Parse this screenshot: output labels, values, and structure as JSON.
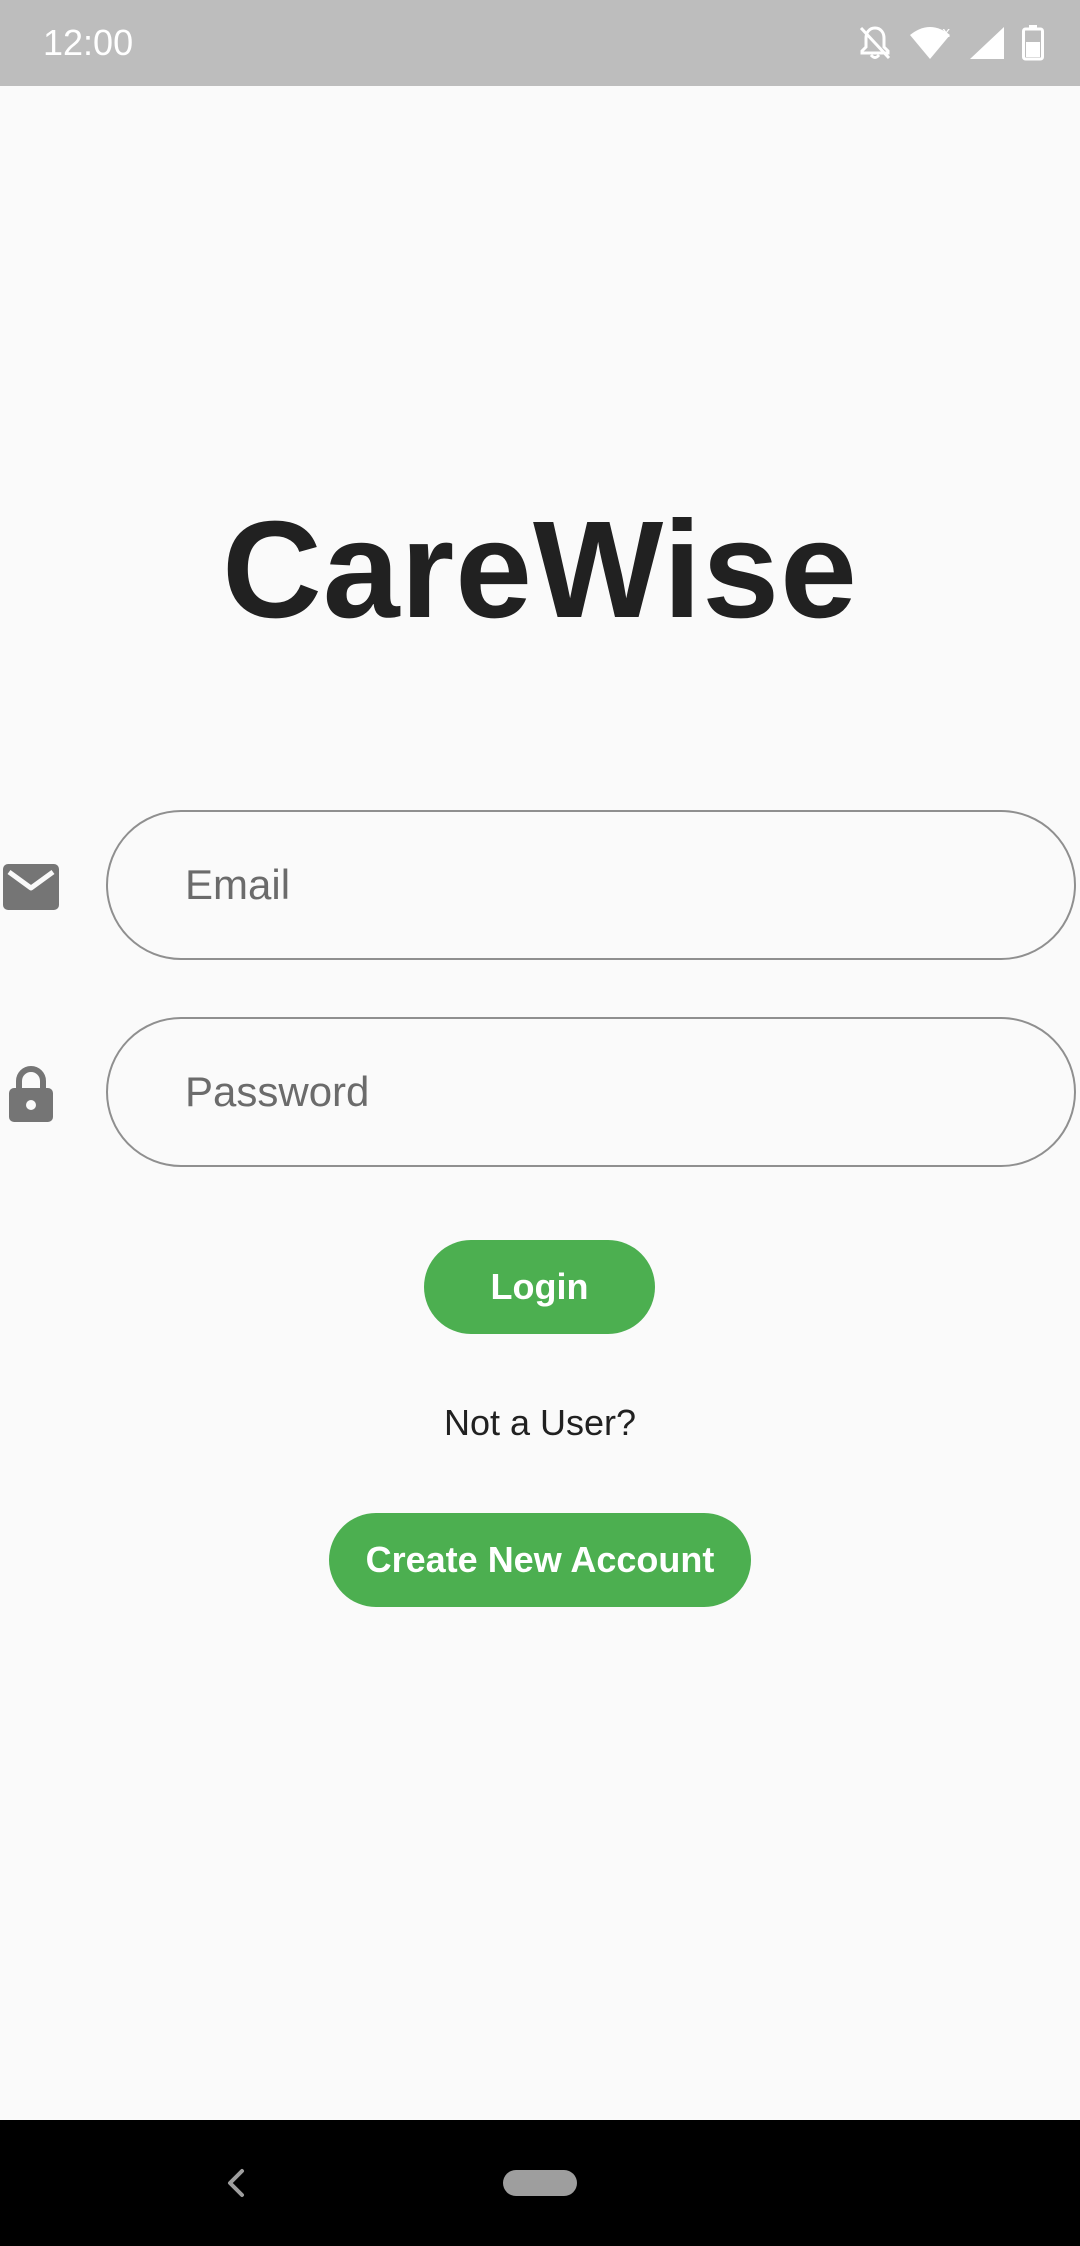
{
  "status_bar": {
    "time": "12:00",
    "icons": [
      "notifications-off-icon",
      "wifi-icon",
      "cell-signal-icon",
      "battery-icon"
    ]
  },
  "app": {
    "title": "CareWise"
  },
  "form": {
    "email": {
      "icon": "email-icon",
      "placeholder": "Email",
      "value": ""
    },
    "password": {
      "icon": "lock-icon",
      "placeholder": "Password",
      "value": ""
    },
    "login_label": "Login",
    "not_user_text": "Not a User?",
    "create_account_label": "Create New Account"
  },
  "nav_bar": {
    "icons": [
      "back-icon",
      "home-pill-icon"
    ]
  },
  "colors": {
    "accent": "#4caf50",
    "status_bar": "#bdbdbd",
    "background": "#fafafa",
    "text": "#212121",
    "field_border": "#8f8f8f",
    "icon_gray": "#757575",
    "nav_bar": "#000000"
  }
}
